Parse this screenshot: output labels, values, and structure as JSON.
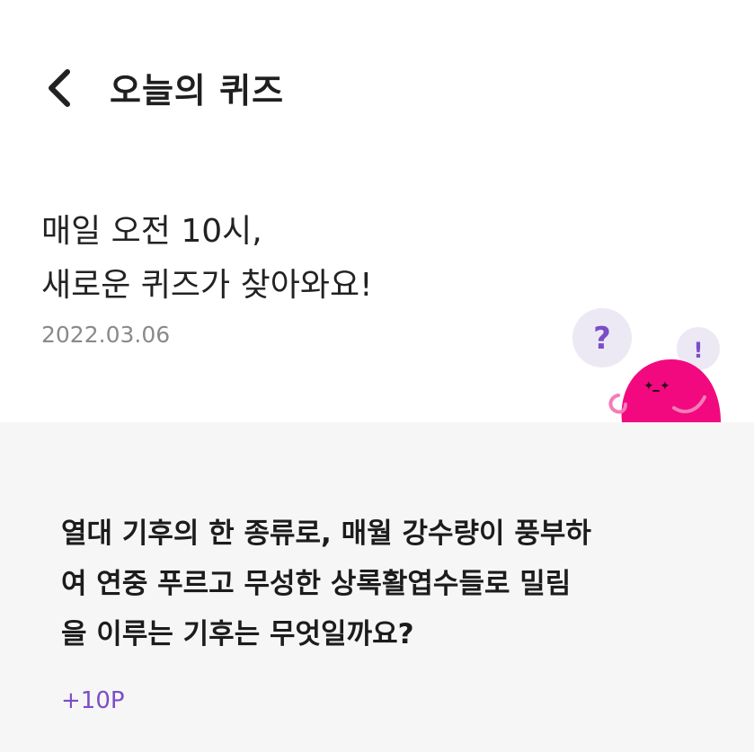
{
  "header": {
    "title": "오늘의 퀴즈",
    "back_icon": "chevron-left-icon"
  },
  "intro": {
    "line1": "매일 오전 10시,",
    "line2": "새로운 퀴즈가 찾아와요!",
    "date": "2022.03.06"
  },
  "mascot": {
    "question_mark": "?",
    "exclamation_mark": "!",
    "body_color": "#f2097f",
    "bubble_color": "#ece9f4",
    "mark_color": "#7b4ec8"
  },
  "quiz": {
    "question_lines": [
      "열대 기후의 한 종류로, 매월 강수량이 풍부하",
      "여 연중 푸르고 무성한 상록활엽수들로 밀림",
      "을 이루는 기후는 무엇일까요?"
    ],
    "reward": "+10P"
  }
}
